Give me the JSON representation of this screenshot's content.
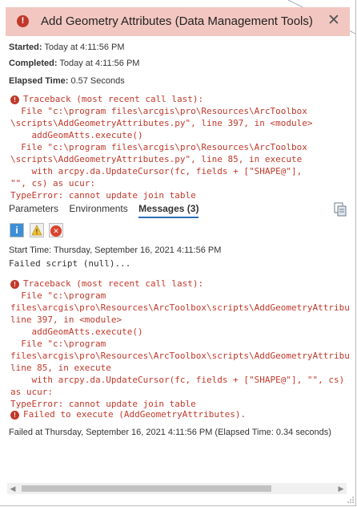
{
  "header": {
    "title": "Add Geometry Attributes (Data Management Tools)",
    "error_icon": "!",
    "close_glyph": "✕"
  },
  "summary": {
    "started_label": "Started:",
    "started_value": "Today at 4:11:56 PM",
    "completed_label": "Completed:",
    "completed_value": "Today at 4:11:56 PM",
    "elapsed_label": "Elapsed Time:",
    "elapsed_value": "0.57 Seconds"
  },
  "top_error": {
    "lines": [
      "Traceback (most recent call last):",
      "  File \"c:\\program files\\arcgis\\pro\\Resources\\ArcToolbox",
      "\\scripts\\AddGeometryAttributes.py\", line 397, in <module>",
      "    addGeomAtts.execute()",
      "  File \"c:\\program files\\arcgis\\pro\\Resources\\ArcToolbox",
      "\\scripts\\AddGeometryAttributes.py\", line 85, in execute",
      "    with arcpy.da.UpdateCursor(fc, fields + [\"SHAPE@\"],",
      "\"\", cs) as ucur:",
      "TypeError: cannot update join table"
    ]
  },
  "tabs": [
    {
      "label": "Parameters"
    },
    {
      "label": "Environments"
    },
    {
      "label": "Messages (3)"
    }
  ],
  "filters": {
    "info_glyph": "i",
    "warning_glyph": "!",
    "error_glyph": "✕"
  },
  "messages": {
    "start_time": "Start Time: Thursday, September 16, 2021 4:11:56 PM",
    "failed_script": "Failed script (null)...",
    "traceback_lines": [
      "Traceback (most recent call last):",
      "  File \"c:\\program",
      "files\\arcgis\\pro\\Resources\\ArcToolbox\\scripts\\AddGeometryAttribu",
      "line 397, in <module>",
      "    addGeomAtts.execute()",
      "  File \"c:\\program",
      "files\\arcgis\\pro\\Resources\\ArcToolbox\\scripts\\AddGeometryAttribu",
      "line 85, in execute",
      "    with arcpy.da.UpdateCursor(fc, fields + [\"SHAPE@\"], \"\", cs)",
      "as ucur:",
      "TypeError: cannot update join table"
    ],
    "failed_execute": "Failed to execute (AddGeometryAttributes).",
    "failed_at": "Failed at Thursday, September 16, 2021 4:11:56 PM (Elapsed Time: 0.34 seconds)"
  },
  "colors": {
    "error_red": "#c0392b",
    "title_bg": "#f3c7c1",
    "info_blue": "#3d8fd6",
    "warning_yellow": "#f2c230",
    "tab_underline": "#2a6fb7"
  }
}
